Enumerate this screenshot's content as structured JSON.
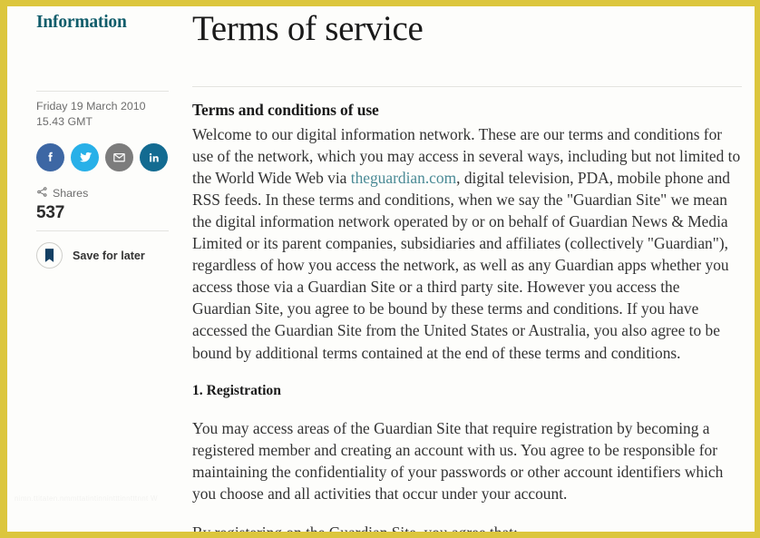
{
  "frame": {
    "border_color": "#dcc63d",
    "page_background": "#fdfdfb"
  },
  "sidebar": {
    "heading": "Information",
    "heading_color": "#115d6b",
    "date": {
      "day_date": "Friday 19 March 2010",
      "time": "15.43 GMT"
    },
    "social_buttons": [
      {
        "name": "facebook",
        "label": "Share on Facebook",
        "icon": "facebook-icon",
        "color": "#3d67a4"
      },
      {
        "name": "twitter",
        "label": "Share on Twitter",
        "icon": "twitter-icon",
        "color": "#28b0e8"
      },
      {
        "name": "email",
        "label": "Share via Email",
        "icon": "email-icon",
        "color": "#7c7c7c"
      },
      {
        "name": "linkedin",
        "label": "Share on LinkedIn",
        "icon": "linkedin-icon",
        "color": "#136b91"
      }
    ],
    "shares": {
      "icon": "share-icon",
      "label": "Shares",
      "count": "537"
    },
    "save": {
      "icon": "bookmark-icon",
      "label": "Save for later"
    },
    "watermark": "nimn.ttitaten.nmmttatintinnintttinntttnnt W"
  },
  "main": {
    "title": "Terms of service",
    "section_heading": "Terms and conditions of use",
    "intro_paragraph": {
      "before_link": "Welcome to our digital information network. These are our terms and conditions for use of the network, which you may access in several ways, including but not limited to the World Wide Web via ",
      "link_text": "theguardian.com",
      "link_color": "#4a8a95",
      "after_link": ", digital television, PDA, mobile phone and RSS feeds. In these terms and conditions, when we say the \"Guardian Site\" we mean the digital information network operated by or on behalf of Guardian News & Media Limited or its parent companies, subsidiaries and affiliates (collectively \"Guardian\"), regardless of how you access the network, as well as any Guardian apps whether you access those via a Guardian Site or a third party site. However you access the Guardian Site, you agree to be bound by these terms and conditions. If you have accessed the Guardian Site from the United States or Australia, you also agree to be bound by additional terms contained at the end of these terms and conditions."
    },
    "registration_heading": "1. Registration",
    "registration_paragraph": "You may access areas of the Guardian Site that require registration by becoming a registered member and creating an account with us. You agree to be responsible for maintaining the confidentiality of your passwords or other account identifiers which you choose and all activities that occur under your account.",
    "agree_paragraph": "By registering on the Guardian Site, you agree that:"
  }
}
